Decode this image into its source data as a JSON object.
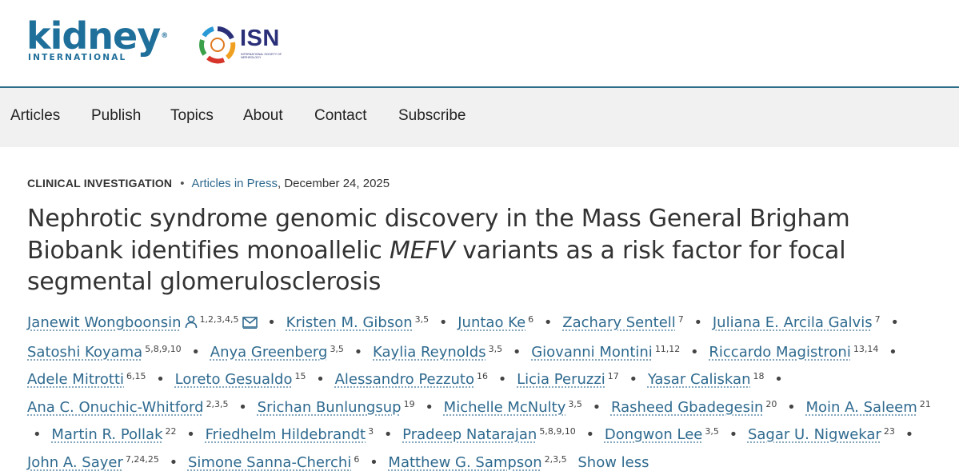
{
  "header": {
    "kidney_logo": {
      "word": "kidney",
      "sub": "INTERNATIONAL",
      "reg": "®"
    },
    "isn_logo": {
      "text": "ISN",
      "sub": "International Society of Nephrology"
    }
  },
  "nav": {
    "items": [
      {
        "label": "Articles"
      },
      {
        "label": "Publish"
      },
      {
        "label": "Topics"
      },
      {
        "label": "About"
      },
      {
        "label": "Contact"
      },
      {
        "label": "Subscribe"
      }
    ]
  },
  "article": {
    "section": "CLINICAL INVESTIGATION",
    "issue_link": "Articles in Press",
    "date": ", December 24, 2025",
    "title_part1": "Nephrotic syndrome genomic discovery in the Mass General Brigham Biobank identifies monoallelic ",
    "title_gene": "MEFV",
    "title_part2": " variants as a risk factor for focal segmental glomerulosclerosis",
    "authors": [
      {
        "name": "Janewit Wongboonsin",
        "aff": "1,2,3,4,5"
      },
      {
        "name": "Kristen M. Gibson",
        "aff": "3,5"
      },
      {
        "name": "Juntao Ke",
        "aff": "6"
      },
      {
        "name": "Zachary Sentell",
        "aff": "7"
      },
      {
        "name": "Juliana E. Arcila Galvis",
        "aff": "7"
      },
      {
        "name": "Satoshi Koyama",
        "aff": "5,8,9,10"
      },
      {
        "name": "Anya Greenberg",
        "aff": "3,5"
      },
      {
        "name": "Kaylia Reynolds",
        "aff": "3,5"
      },
      {
        "name": "Giovanni Montini",
        "aff": "11,12"
      },
      {
        "name": "Riccardo Magistroni",
        "aff": "13,14"
      },
      {
        "name": "Adele Mitrotti",
        "aff": "6,15"
      },
      {
        "name": "Loreto Gesualdo",
        "aff": "15"
      },
      {
        "name": "Alessandro Pezzuto",
        "aff": "16"
      },
      {
        "name": "Licia Peruzzi",
        "aff": "17"
      },
      {
        "name": "Yasar Caliskan",
        "aff": "18"
      },
      {
        "name": "Ana C. Onuchic-Whitford",
        "aff": "2,3,5"
      },
      {
        "name": "Srichan Bunlungsup",
        "aff": "19"
      },
      {
        "name": "Michelle McNulty",
        "aff": "3,5"
      },
      {
        "name": "Rasheed Gbadegesin",
        "aff": "20"
      },
      {
        "name": "Moin A. Saleem",
        "aff": "21"
      },
      {
        "name": "Martin R. Pollak",
        "aff": "22"
      },
      {
        "name": "Friedhelm Hildebrandt",
        "aff": "3"
      },
      {
        "name": "Pradeep Natarajan",
        "aff": "5,8,9,10"
      },
      {
        "name": "Dongwon Lee",
        "aff": "3,5"
      },
      {
        "name": "Sagar U. Nigwekar",
        "aff": "23"
      },
      {
        "name": "John A. Sayer",
        "aff": "7,24,25"
      },
      {
        "name": "Simone Sanna-Cherchi",
        "aff": "6"
      },
      {
        "name": "Matthew G. Sampson",
        "aff": "2,3,5"
      }
    ],
    "show_less": "Show less",
    "separator": "•"
  },
  "icons": {
    "author_profile": "person-icon",
    "author_email": "envelope-icon"
  },
  "colors": {
    "link": "#2f6a8f",
    "brand": "#1f6f9b",
    "nav_bg": "#f1f1f1",
    "header_rule": "#2c6d8a"
  }
}
